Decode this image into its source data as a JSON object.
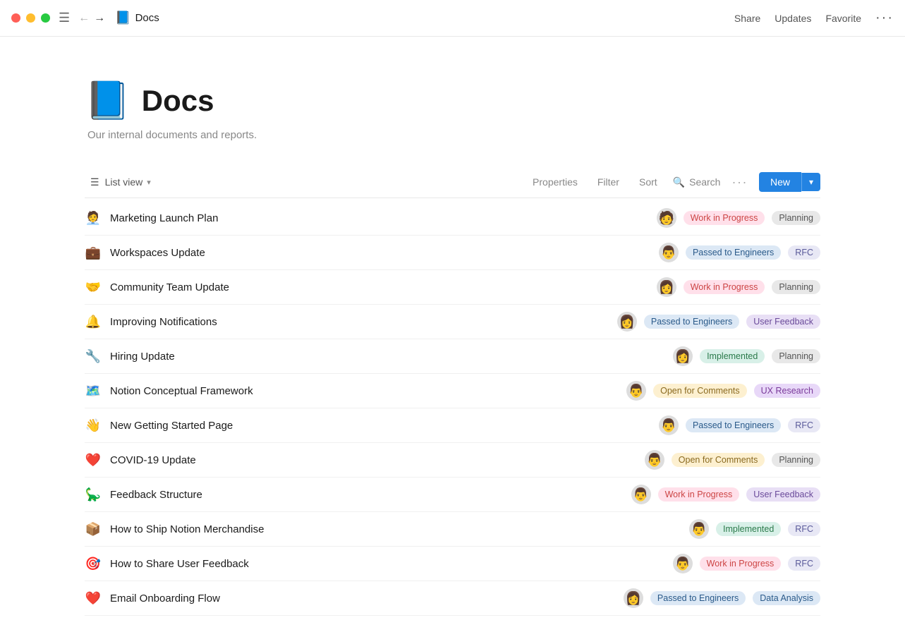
{
  "titlebar": {
    "page_icon": "📘",
    "page_title": "Docs",
    "actions": {
      "share": "Share",
      "updates": "Updates",
      "favorite": "Favorite",
      "more": "···"
    }
  },
  "page": {
    "emoji": "📘",
    "title": "Docs",
    "description": "Our internal documents and reports."
  },
  "toolbar": {
    "list_view": "List view",
    "properties": "Properties",
    "filter": "Filter",
    "sort": "Sort",
    "search": "Search",
    "more": "···",
    "new_btn": "New"
  },
  "docs": [
    {
      "emoji": "🧑‍💼",
      "name": "Marketing Launch Plan",
      "avatar": "🧑",
      "tags": [
        {
          "label": "Work in Progress",
          "style": "wip"
        },
        {
          "label": "Planning",
          "style": "planning"
        }
      ]
    },
    {
      "emoji": "💼",
      "name": "Workspaces Update",
      "avatar": "👨",
      "tags": [
        {
          "label": "Passed to Engineers",
          "style": "engineers"
        },
        {
          "label": "RFC",
          "style": "rfc"
        }
      ]
    },
    {
      "emoji": "🤝",
      "name": "Community Team Update",
      "avatar": "👩",
      "tags": [
        {
          "label": "Work in Progress",
          "style": "wip"
        },
        {
          "label": "Planning",
          "style": "planning"
        }
      ]
    },
    {
      "emoji": "🔔",
      "name": "Improving Notifications",
      "avatar": "👩",
      "tags": [
        {
          "label": "Passed to Engineers",
          "style": "engineers"
        },
        {
          "label": "User Feedback",
          "style": "feedback"
        }
      ]
    },
    {
      "emoji": "🔧",
      "name": "Hiring Update",
      "avatar": "👩",
      "tags": [
        {
          "label": "Implemented",
          "style": "implemented"
        },
        {
          "label": "Planning",
          "style": "planning"
        }
      ]
    },
    {
      "emoji": "🗺️",
      "name": "Notion Conceptual Framework",
      "avatar": "👨",
      "tags": [
        {
          "label": "Open for Comments",
          "style": "open"
        },
        {
          "label": "UX Research",
          "style": "ux"
        }
      ]
    },
    {
      "emoji": "👋",
      "name": "New Getting Started Page",
      "avatar": "👨",
      "tags": [
        {
          "label": "Passed to Engineers",
          "style": "engineers"
        },
        {
          "label": "RFC",
          "style": "rfc"
        }
      ]
    },
    {
      "emoji": "❤️",
      "name": "COVID-19 Update",
      "avatar": "👨",
      "tags": [
        {
          "label": "Open for Comments",
          "style": "open"
        },
        {
          "label": "Planning",
          "style": "planning"
        }
      ]
    },
    {
      "emoji": "🦕",
      "name": "Feedback Structure",
      "avatar": "👨",
      "tags": [
        {
          "label": "Work in Progress",
          "style": "wip"
        },
        {
          "label": "User Feedback",
          "style": "feedback"
        }
      ]
    },
    {
      "emoji": "📦",
      "name": "How to Ship Notion Merchandise",
      "avatar": "👨",
      "tags": [
        {
          "label": "Implemented",
          "style": "implemented"
        },
        {
          "label": "RFC",
          "style": "rfc"
        }
      ]
    },
    {
      "emoji": "🎯",
      "name": "How to Share User Feedback",
      "avatar": "👨",
      "tags": [
        {
          "label": "Work in Progress",
          "style": "wip"
        },
        {
          "label": "RFC",
          "style": "rfc"
        }
      ]
    },
    {
      "emoji": "❤️",
      "name": "Email Onboarding Flow",
      "avatar": "👩",
      "tags": [
        {
          "label": "Passed to Engineers",
          "style": "engineers"
        },
        {
          "label": "Data Analysis",
          "style": "data"
        }
      ]
    }
  ]
}
